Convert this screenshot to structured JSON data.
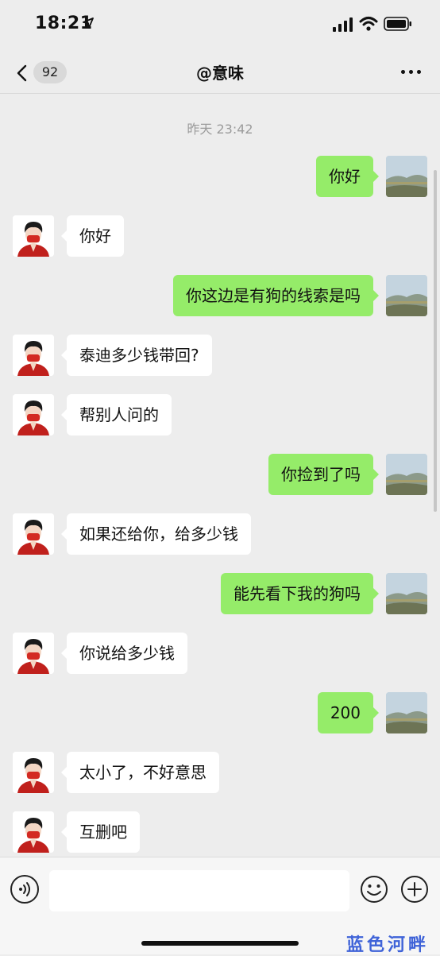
{
  "status_bar": {
    "time": "18:21",
    "icons": [
      "location-arrow-icon",
      "signal-icon",
      "wifi-icon",
      "battery-icon"
    ]
  },
  "nav": {
    "unread_count": "92",
    "title": "@意味",
    "back_icon": "chevron-left-icon",
    "more_icon": "more-dots-icon"
  },
  "chat": {
    "timestamp": "昨天 23:42",
    "messages": [
      {
        "side": "out",
        "text": "你好"
      },
      {
        "side": "in",
        "text": "你好"
      },
      {
        "side": "out",
        "text": "你这边是有狗的线索是吗"
      },
      {
        "side": "in",
        "text": "泰迪多少钱带回?"
      },
      {
        "side": "in",
        "text": "帮别人问的"
      },
      {
        "side": "out",
        "text": "你捡到了吗"
      },
      {
        "side": "in",
        "text": "如果还给你，给多少钱"
      },
      {
        "side": "out",
        "text": "能先看下我的狗吗"
      },
      {
        "side": "in",
        "text": "你说给多少钱"
      },
      {
        "side": "out",
        "text": "200"
      },
      {
        "side": "in",
        "text": "太小了，不好意思"
      },
      {
        "side": "in",
        "text": "互删吧"
      }
    ]
  },
  "input_bar": {
    "voice_icon": "voice-icon",
    "emoji_icon": "emoji-icon",
    "add_icon": "plus-circle-icon",
    "placeholder": ""
  },
  "watermark": "蓝色河畔",
  "colors": {
    "background": "#ededed",
    "outgoing_bubble": "#95ec69",
    "incoming_bubble": "#ffffff",
    "watermark": "#3f63d8"
  }
}
